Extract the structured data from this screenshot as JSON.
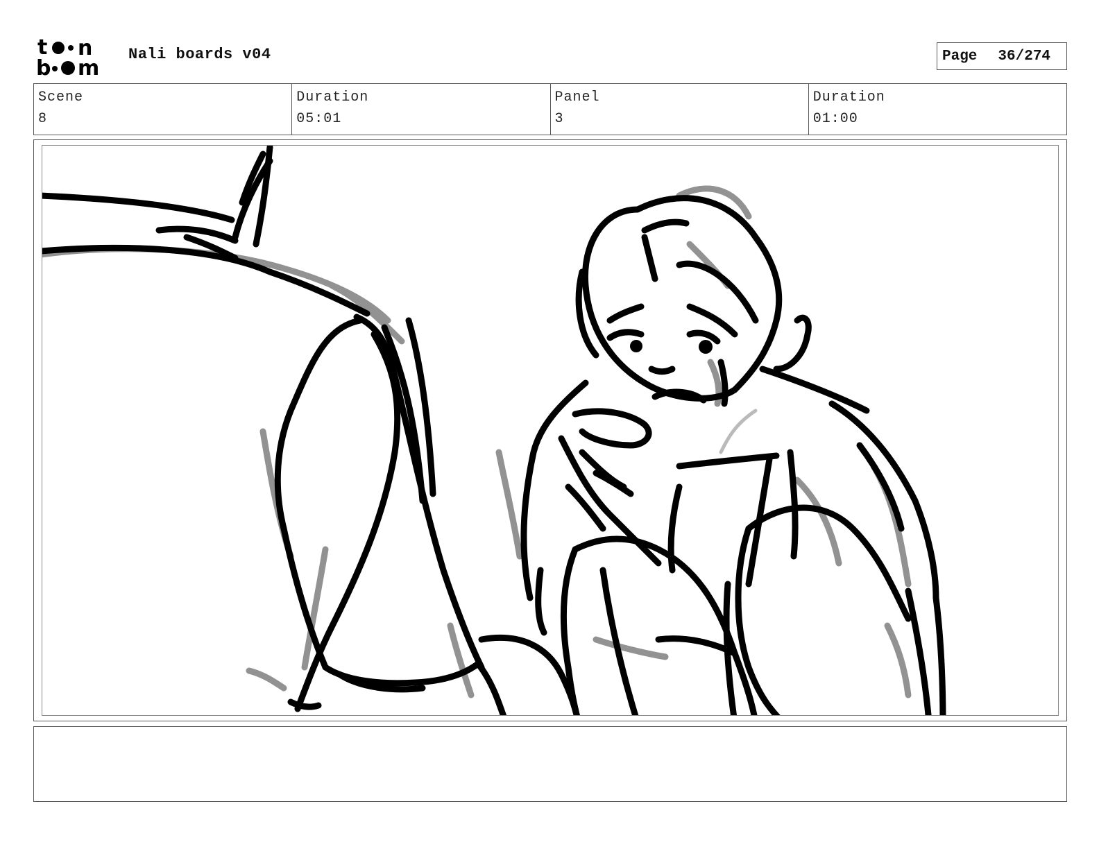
{
  "header": {
    "logo_text": "toon boom",
    "project_title": "Nali boards v04",
    "page_label": "Page",
    "page_value": "36/274"
  },
  "info": {
    "scene_label": "Scene",
    "scene_value": "8",
    "scene_duration_label": "Duration",
    "scene_duration_value": "05:01",
    "panel_label": "Panel",
    "panel_value": "3",
    "panel_duration_label": "Duration",
    "panel_duration_value": "01:00"
  },
  "notes": {
    "text": ""
  }
}
